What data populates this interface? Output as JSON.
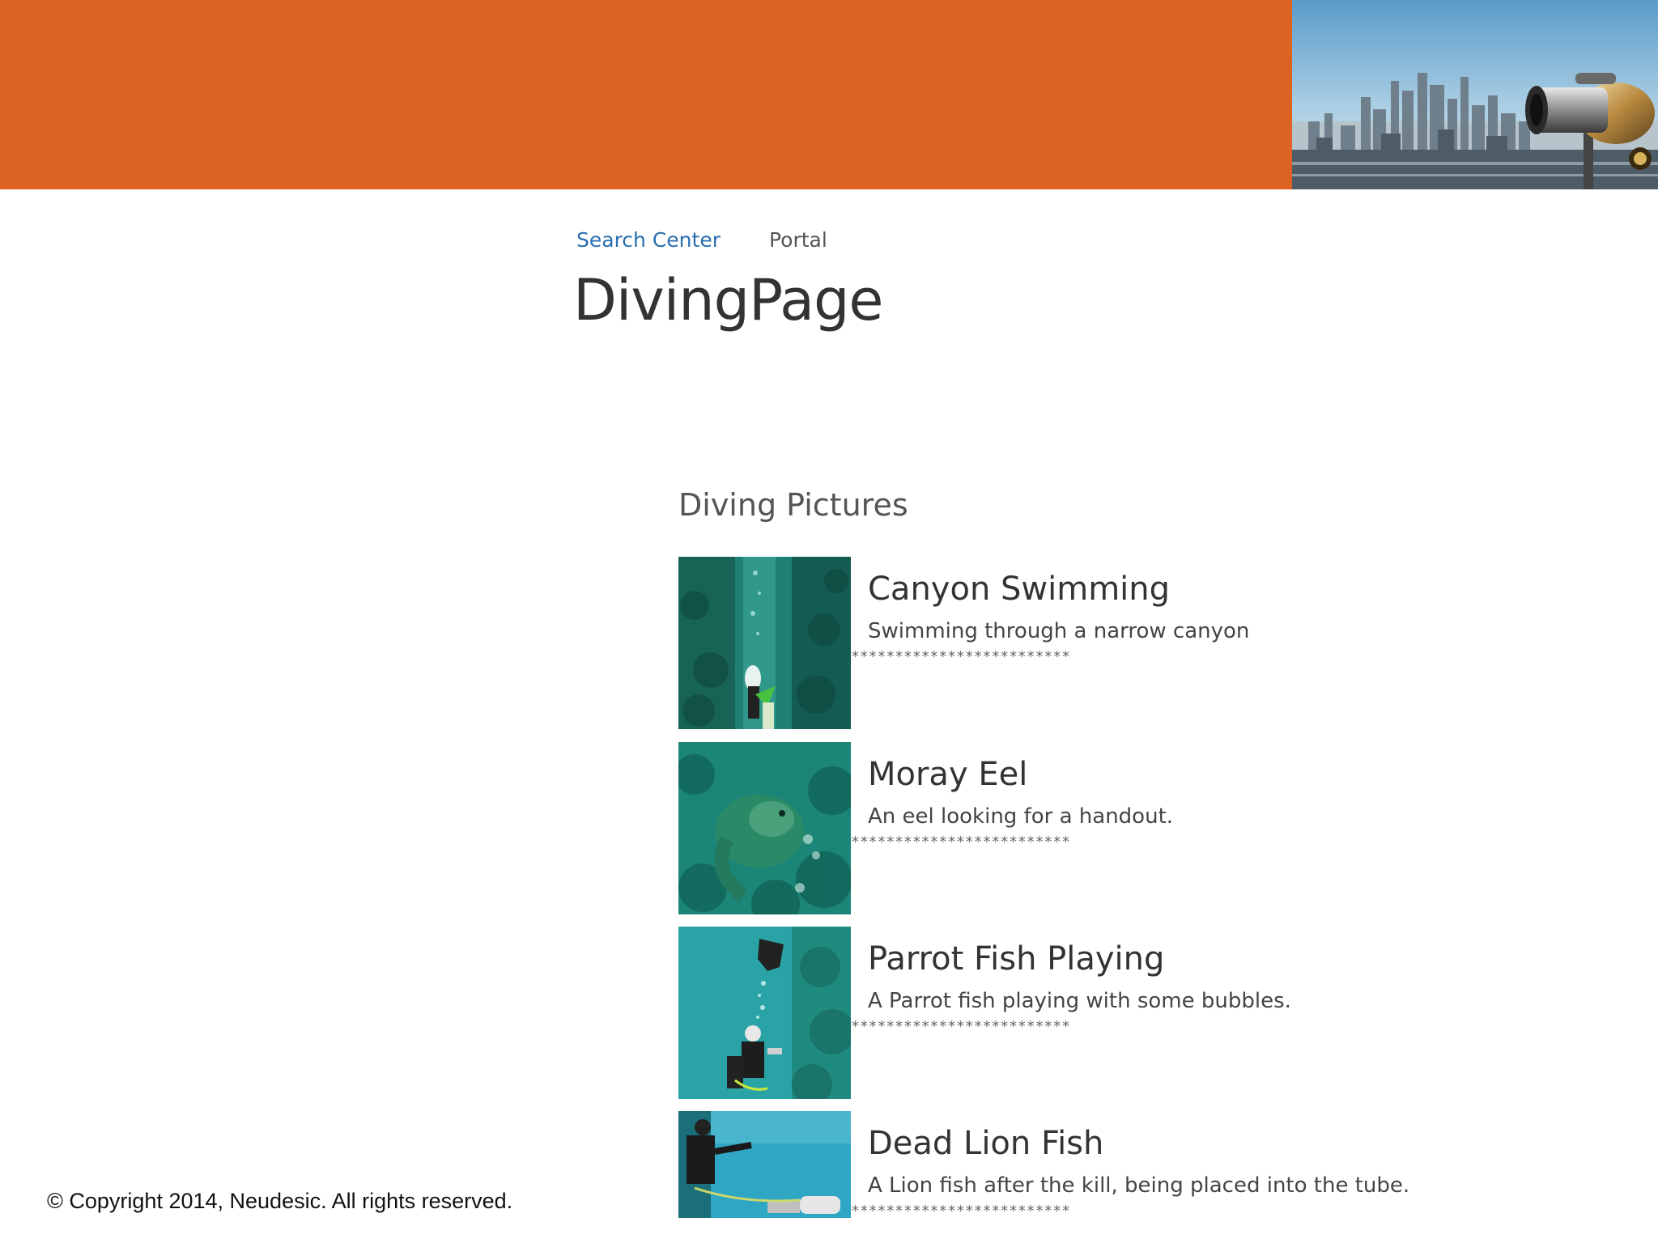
{
  "nav": {
    "search_center": "Search Center",
    "portal": "Portal"
  },
  "page": {
    "title": "DivingPage"
  },
  "section": {
    "title": "Diving Pictures"
  },
  "items": [
    {
      "title": "Canyon Swimming",
      "description": "Swimming through a narrow canyon",
      "separator": "*************************"
    },
    {
      "title": "Moray Eel",
      "description": "An eel looking for a handout.",
      "separator": "*************************"
    },
    {
      "title": "Parrot Fish Playing",
      "description": "A Parrot fish playing with some bubbles.",
      "separator": "*************************"
    },
    {
      "title": "Dead Lion Fish",
      "description": "A Lion fish after the kill, being placed into the tube.",
      "separator": "*************************"
    }
  ],
  "footer": {
    "copyright": "© Copyright 2014, Neudesic. All rights reserved."
  },
  "colors": {
    "banner": "#dc6322",
    "link": "#2a6fb0"
  }
}
